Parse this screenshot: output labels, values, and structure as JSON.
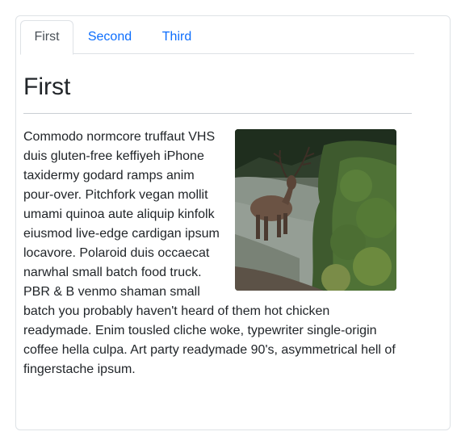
{
  "tabs": [
    {
      "label": "First",
      "active": true
    },
    {
      "label": "Second",
      "active": false
    },
    {
      "label": "Third",
      "active": false
    }
  ],
  "content": {
    "heading": "First",
    "paragraph": "Commodo normcore truffaut VHS duis gluten-free keffiyeh iPhone taxidermy godard ramps anim pour-over. Pitchfork vegan mollit umami quinoa aute aliquip kinfolk eiusmod live-edge cardigan ipsum locavore. Polaroid duis occaecat narwhal small batch food truck. PBR & B venmo shaman small batch you probably haven't heard of them hot chicken readymade. Enim tousled cliche woke, typewriter single-origin coffee hella culpa. Art party readymade 90's, asymmetrical hell of fingerstache ipsum."
  },
  "colors": {
    "link": "#0d6efd",
    "active_tab_text": "#495057",
    "border": "#dee2e6",
    "text": "#212529"
  }
}
